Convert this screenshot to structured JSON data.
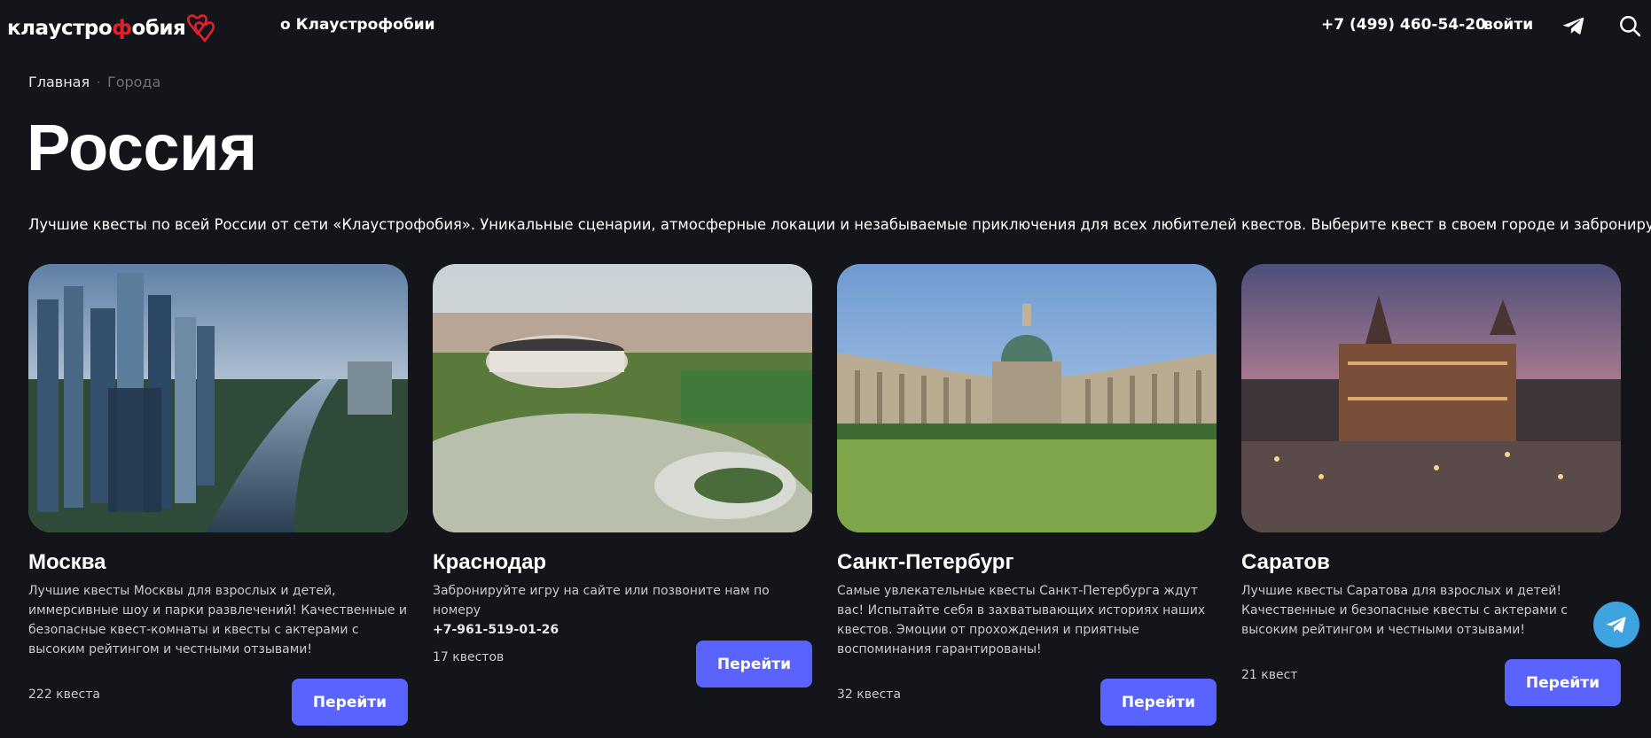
{
  "header": {
    "logo_text_pre": "клаустро",
    "logo_text_key": "ф",
    "logo_text_post": "обия",
    "nav_about": "о Клаустрофобии",
    "phone": "+7 (499) 460-54-20",
    "login": "войти"
  },
  "breadcrumb": {
    "home": "Главная",
    "separator": "·",
    "current": "Города"
  },
  "page": {
    "title": "Россия",
    "intro": "Лучшие квесты по всей России от сети «Клаустрофобия». Уникальные сценарии, атмосферные локации и незабываемые приключения для всех любителей квестов. Выберите квест в своем городе и забронируйте его!"
  },
  "cities": [
    {
      "title": "Москва",
      "description": "Лучшие квесты Москвы для взрослых и детей, иммерсивные шоу и парки развлечений! Качественные и безопасные квест-комнаты и квесты с актерами с высоким рейтингом и честными отзывами!",
      "count": "222 квеста",
      "button": "Перейти"
    },
    {
      "title": "Краснодар",
      "description": "Забронируйте игру на сайте или позвоните нам по номеру",
      "phone": "+7-961-519-01-26",
      "count": "17 квестов",
      "button": "Перейти"
    },
    {
      "title": "Санкт-Петербург",
      "description": "Самые увлекательные квесты Санкт-Петербурга ждут вас! Испытайте себя в захватывающих историях наших квестов. Эмоции от прохождения и приятные воспоминания гарантированы!",
      "count": "32 квеста",
      "button": "Перейти"
    },
    {
      "title": "Саратов",
      "description": "Лучшие квесты Саратова для взрослых и детей! Качественные и безопасные квесты с актерами с высоким рейтингом и честными отзывами!",
      "count": "21 квест",
      "button": "Перейти"
    }
  ],
  "colors": {
    "background": "#14151b",
    "accent": "#5a63fd",
    "logo_red": "#e0212b",
    "telegram": "#3fa3e0"
  },
  "icons": {
    "telegram": "telegram-icon",
    "search": "search-icon",
    "hearts": "hearts-icon"
  }
}
